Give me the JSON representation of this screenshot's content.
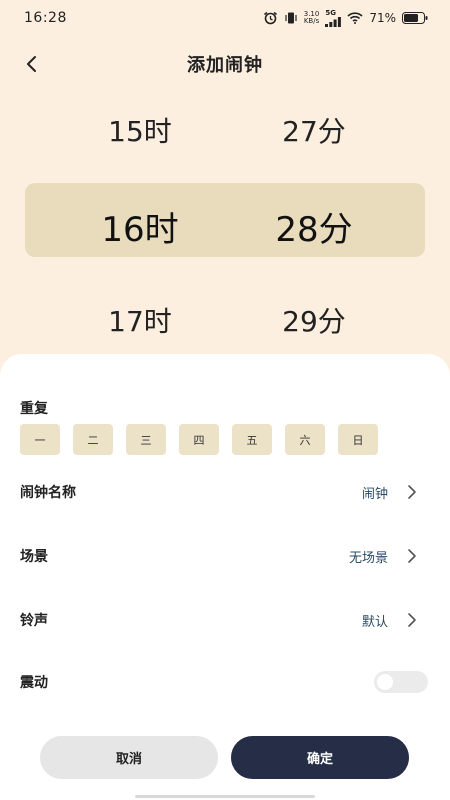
{
  "status_bar": {
    "time": "16:28",
    "net_speed_value": "3.10",
    "net_speed_unit": "KB/s",
    "signal_label": "5G",
    "battery_percent": "71%"
  },
  "header": {
    "title": "添加闹钟",
    "back_icon": "chevron-left-icon"
  },
  "picker": {
    "prev": {
      "hour": "15时",
      "minute": "27分"
    },
    "selected": {
      "hour": "16时",
      "minute": "28分"
    },
    "next": {
      "hour": "17时",
      "minute": "29分"
    },
    "highlight_color": "#e8dcbd"
  },
  "sheet": {
    "repeat_label": "重复",
    "days": [
      "一",
      "二",
      "三",
      "四",
      "五",
      "六",
      "日"
    ],
    "name": {
      "label": "闹钟名称",
      "value": "闹钟"
    },
    "scene": {
      "label": "场景",
      "value": "无场景"
    },
    "ringtone": {
      "label": "铃声",
      "value": "默认"
    },
    "vibrate": {
      "label": "震动",
      "enabled": false
    },
    "cancel_label": "取消",
    "confirm_label": "确定"
  },
  "colors": {
    "background": "#fcefe0",
    "confirm_button": "#262d47",
    "value_text": "#2c4a66"
  }
}
